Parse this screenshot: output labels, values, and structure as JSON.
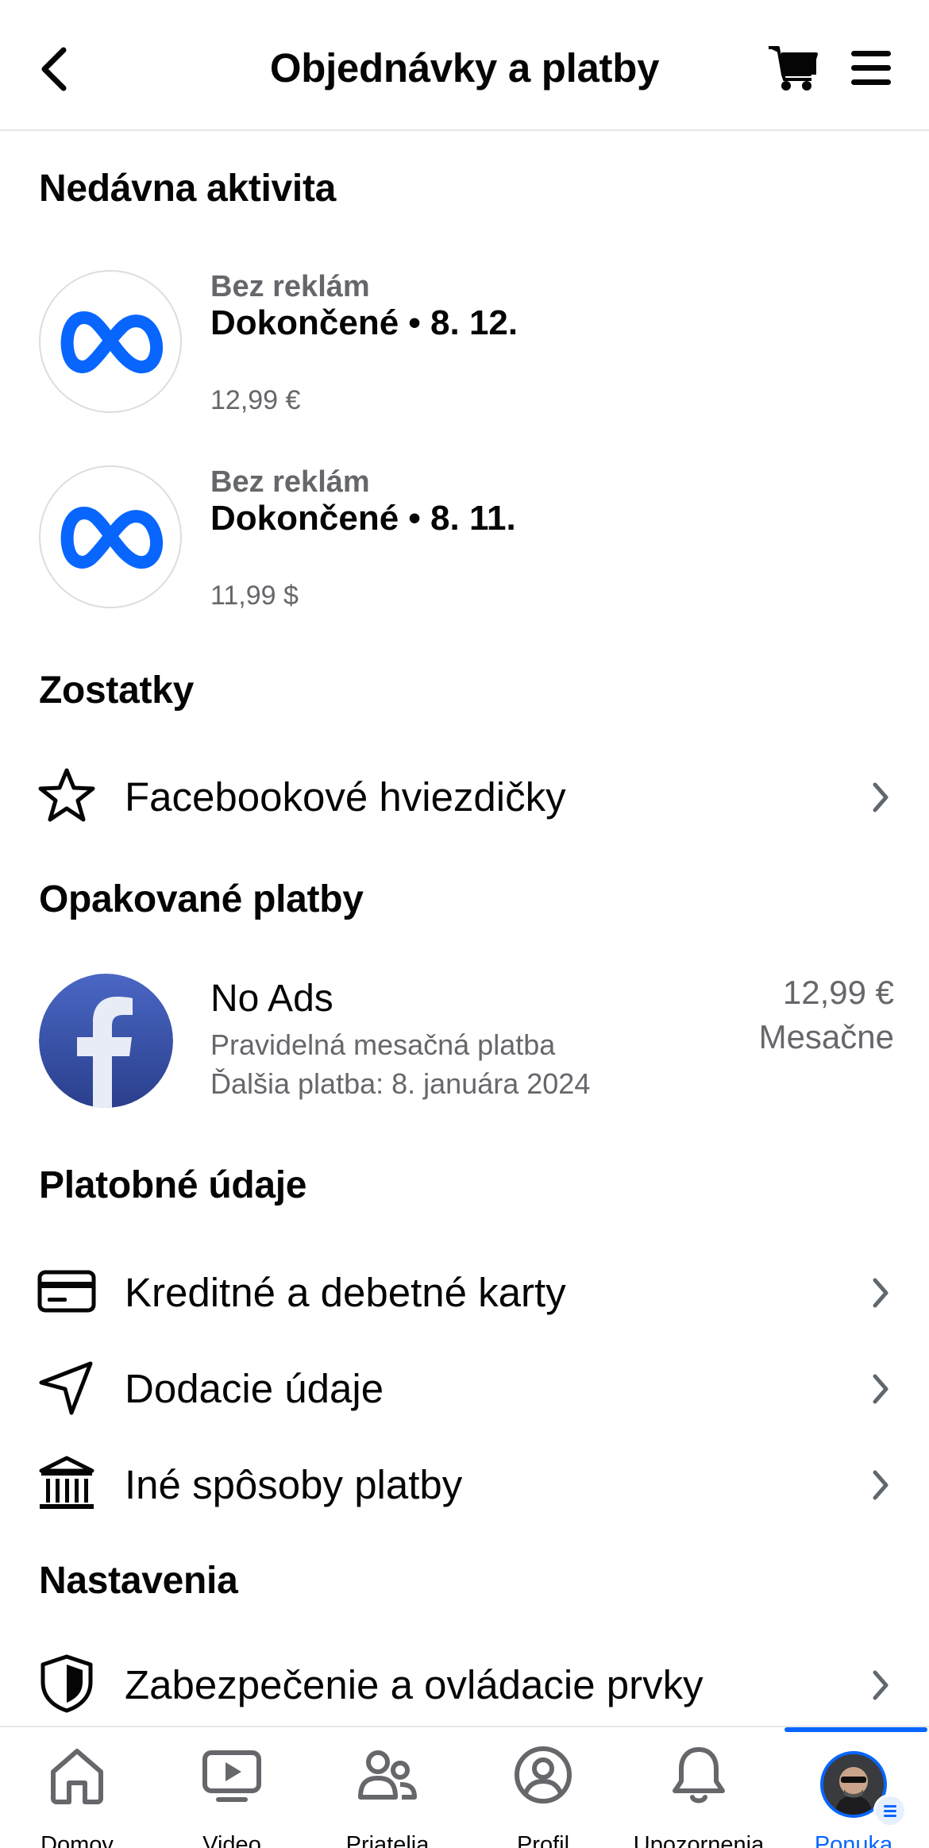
{
  "header": {
    "title": "Objednávky a platby"
  },
  "recent_activity": {
    "title": "Nedávna aktivita",
    "items": [
      {
        "kind": "Bez reklám",
        "status": "Dokončené • 8. 12.",
        "amount": "12,99 €"
      },
      {
        "kind": "Bez reklám",
        "status": "Dokončené • 8. 11.",
        "amount": "11,99 $"
      }
    ]
  },
  "balances": {
    "title": "Zostatky",
    "items": [
      {
        "label": "Facebookové hviezdičky",
        "icon": "star-icon"
      }
    ]
  },
  "recurring": {
    "title": "Opakované platby",
    "item": {
      "name": "No Ads",
      "description": "Pravidelná mesačná platba",
      "next_payment": "Ďalšia platba: 8. januára 2024",
      "price": "12,99 €",
      "period": "Mesačne"
    }
  },
  "payment_info": {
    "title": "Platobné údaje",
    "items": [
      {
        "label": "Kreditné a debetné karty",
        "icon": "credit-card-icon"
      },
      {
        "label": "Dodacie údaje",
        "icon": "location-arrow-icon"
      },
      {
        "label": "Iné spôsoby platby",
        "icon": "bank-icon"
      }
    ]
  },
  "settings": {
    "title": "Nastavenia",
    "items": [
      {
        "label": "Zabezpečenie a ovládacie prvky",
        "icon": "shield-icon"
      }
    ]
  },
  "bottom_nav": {
    "tabs": [
      {
        "label": "Domov",
        "icon": "home-icon"
      },
      {
        "label": "Video",
        "icon": "video-icon"
      },
      {
        "label": "Priatelia",
        "icon": "friends-icon"
      },
      {
        "label": "Profil",
        "icon": "profile-icon"
      },
      {
        "label": "Upozornenia",
        "icon": "bell-icon"
      },
      {
        "label": "Ponuka",
        "icon": "avatar-menu-icon",
        "active": true
      }
    ]
  },
  "colors": {
    "accent": "#0866ff",
    "meta_logo": "#0866ff",
    "secondary_text": "#65676b"
  }
}
